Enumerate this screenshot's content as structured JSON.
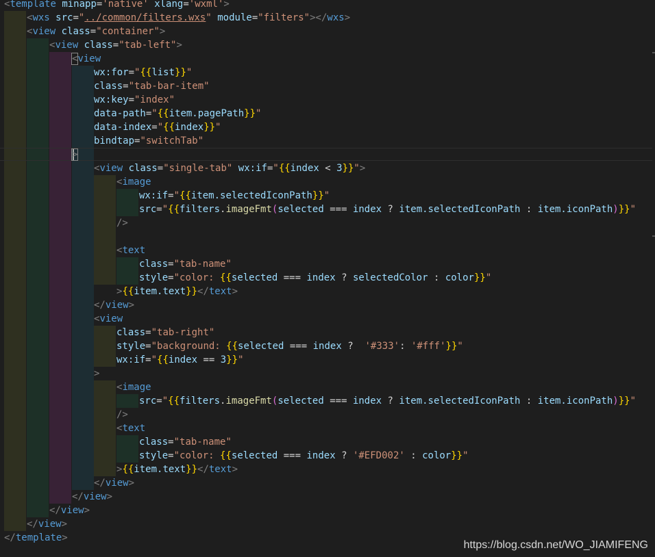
{
  "editor": {
    "lines": [
      [
        [
          "tagb",
          "<"
        ],
        [
          "tag",
          "template"
        ],
        [
          "op",
          " "
        ],
        [
          "attr",
          "minapp"
        ],
        [
          "op",
          "="
        ],
        [
          "str",
          "'native'"
        ],
        [
          "op",
          " "
        ],
        [
          "attr",
          "xlang"
        ],
        [
          "op",
          "="
        ],
        [
          "str",
          "'wxml'"
        ],
        [
          "tagb",
          ">"
        ]
      ],
      [
        [
          "tagb",
          "<"
        ],
        [
          "tag",
          "wxs"
        ],
        [
          "op",
          " "
        ],
        [
          "attr",
          "src"
        ],
        [
          "op",
          "="
        ],
        [
          "str",
          "\""
        ],
        [
          "stru",
          "../common/filters.wxs"
        ],
        [
          "str",
          "\""
        ],
        [
          "op",
          " "
        ],
        [
          "attr",
          "module"
        ],
        [
          "op",
          "="
        ],
        [
          "str",
          "\"filters\""
        ],
        [
          "tagb",
          "></"
        ],
        [
          "tag",
          "wxs"
        ],
        [
          "tagb",
          ">"
        ]
      ],
      [
        [
          "tagb",
          "<"
        ],
        [
          "tag",
          "view"
        ],
        [
          "op",
          " "
        ],
        [
          "attr",
          "class"
        ],
        [
          "op",
          "="
        ],
        [
          "str",
          "\"container\""
        ],
        [
          "tagb",
          ">"
        ]
      ],
      [
        [
          "tagb",
          "<"
        ],
        [
          "tag",
          "view"
        ],
        [
          "op",
          " "
        ],
        [
          "attr",
          "class"
        ],
        [
          "op",
          "="
        ],
        [
          "str",
          "\"tab-left\""
        ],
        [
          "tagb",
          ">"
        ]
      ],
      [
        [
          "tagb",
          "<"
        ],
        [
          "tag",
          "view"
        ]
      ],
      [
        [
          "attr",
          "wx:for"
        ],
        [
          "op",
          "="
        ],
        [
          "str",
          "\""
        ],
        [
          "b1",
          "{{"
        ],
        [
          "var",
          "list"
        ],
        [
          "b1",
          "}}"
        ],
        [
          "str",
          "\""
        ]
      ],
      [
        [
          "attr",
          "class"
        ],
        [
          "op",
          "="
        ],
        [
          "str",
          "\"tab-bar-item\""
        ]
      ],
      [
        [
          "attr",
          "wx:key"
        ],
        [
          "op",
          "="
        ],
        [
          "str",
          "\"index\""
        ]
      ],
      [
        [
          "attr",
          "data-path"
        ],
        [
          "op",
          "="
        ],
        [
          "str",
          "\""
        ],
        [
          "b1",
          "{{"
        ],
        [
          "var",
          "item.pagePath"
        ],
        [
          "b1",
          "}}"
        ],
        [
          "str",
          "\""
        ]
      ],
      [
        [
          "attr",
          "data-index"
        ],
        [
          "op",
          "="
        ],
        [
          "str",
          "\""
        ],
        [
          "b1",
          "{{"
        ],
        [
          "var",
          "index"
        ],
        [
          "b1",
          "}}"
        ],
        [
          "str",
          "\""
        ]
      ],
      [
        [
          "attr",
          "bindtap"
        ],
        [
          "op",
          "="
        ],
        [
          "str",
          "\"switchTab\""
        ]
      ],
      [
        [
          "tagb",
          ">"
        ]
      ],
      [
        [
          "tagb",
          "<"
        ],
        [
          "tag",
          "view"
        ],
        [
          "op",
          " "
        ],
        [
          "attr",
          "class"
        ],
        [
          "op",
          "="
        ],
        [
          "str",
          "\"single-tab\""
        ],
        [
          "op",
          " "
        ],
        [
          "attr",
          "wx:if"
        ],
        [
          "op",
          "="
        ],
        [
          "str",
          "\""
        ],
        [
          "b1",
          "{{"
        ],
        [
          "var",
          "index"
        ],
        [
          "op",
          " < "
        ],
        [
          "var",
          "3"
        ],
        [
          "b1",
          "}}"
        ],
        [
          "str",
          "\""
        ],
        [
          "tagb",
          ">"
        ]
      ],
      [
        [
          "tagb",
          "<"
        ],
        [
          "tag",
          "image"
        ]
      ],
      [
        [
          "attr",
          "wx:if"
        ],
        [
          "op",
          "="
        ],
        [
          "str",
          "\""
        ],
        [
          "b1",
          "{{"
        ],
        [
          "var",
          "item.selectedIconPath"
        ],
        [
          "b1",
          "}}"
        ],
        [
          "str",
          "\""
        ]
      ],
      [
        [
          "attr",
          "src"
        ],
        [
          "op",
          "="
        ],
        [
          "str",
          "\""
        ],
        [
          "b1",
          "{{"
        ],
        [
          "var",
          "filters"
        ],
        [
          "op",
          "."
        ],
        [
          "fn",
          "imageFmt"
        ],
        [
          "b2",
          "("
        ],
        [
          "var",
          "selected"
        ],
        [
          "op",
          " === "
        ],
        [
          "var",
          "index"
        ],
        [
          "op",
          " ? "
        ],
        [
          "var",
          "item.selectedIconPath"
        ],
        [
          "op",
          " : "
        ],
        [
          "var",
          "item.iconPath"
        ],
        [
          "b2",
          ")"
        ],
        [
          "b1",
          "}}"
        ],
        [
          "str",
          "\""
        ]
      ],
      [
        [
          "tagb",
          "/>"
        ]
      ],
      [],
      [
        [
          "tagb",
          "<"
        ],
        [
          "tag",
          "text"
        ]
      ],
      [
        [
          "attr",
          "class"
        ],
        [
          "op",
          "="
        ],
        [
          "str",
          "\"tab-name\""
        ]
      ],
      [
        [
          "attr",
          "style"
        ],
        [
          "op",
          "="
        ],
        [
          "str",
          "\"color: "
        ],
        [
          "b1",
          "{{"
        ],
        [
          "var",
          "selected"
        ],
        [
          "op",
          " === "
        ],
        [
          "var",
          "index"
        ],
        [
          "op",
          " ? "
        ],
        [
          "var",
          "selectedColor"
        ],
        [
          "op",
          " : "
        ],
        [
          "var",
          "color"
        ],
        [
          "b1",
          "}}"
        ],
        [
          "str",
          "\""
        ]
      ],
      [
        [
          "tagb",
          ">"
        ],
        [
          "b1",
          "{{"
        ],
        [
          "var",
          "item.text"
        ],
        [
          "b1",
          "}}"
        ],
        [
          "tagb",
          "</"
        ],
        [
          "tag",
          "text"
        ],
        [
          "tagb",
          ">"
        ]
      ],
      [
        [
          "tagb",
          "</"
        ],
        [
          "tag",
          "view"
        ],
        [
          "tagb",
          ">"
        ]
      ],
      [
        [
          "tagb",
          "<"
        ],
        [
          "tag",
          "view"
        ]
      ],
      [
        [
          "attr",
          "class"
        ],
        [
          "op",
          "="
        ],
        [
          "str",
          "\"tab-right\""
        ]
      ],
      [
        [
          "attr",
          "style"
        ],
        [
          "op",
          "="
        ],
        [
          "str",
          "\"background: "
        ],
        [
          "b1",
          "{{"
        ],
        [
          "var",
          "selected"
        ],
        [
          "op",
          " === "
        ],
        [
          "var",
          "index"
        ],
        [
          "op",
          " ?  "
        ],
        [
          "str",
          "'#333'"
        ],
        [
          "op",
          ": "
        ],
        [
          "str",
          "'#fff'"
        ],
        [
          "b1",
          "}}"
        ],
        [
          "str",
          "\""
        ]
      ],
      [
        [
          "attr",
          "wx:if"
        ],
        [
          "op",
          "="
        ],
        [
          "str",
          "\""
        ],
        [
          "b1",
          "{{"
        ],
        [
          "var",
          "index"
        ],
        [
          "op",
          " == "
        ],
        [
          "var",
          "3"
        ],
        [
          "b1",
          "}}"
        ],
        [
          "str",
          "\""
        ]
      ],
      [
        [
          "tagb",
          ">"
        ]
      ],
      [
        [
          "tagb",
          "<"
        ],
        [
          "tag",
          "image"
        ]
      ],
      [
        [
          "attr",
          "src"
        ],
        [
          "op",
          "="
        ],
        [
          "str",
          "\""
        ],
        [
          "b1",
          "{{"
        ],
        [
          "var",
          "filters"
        ],
        [
          "op",
          "."
        ],
        [
          "fn",
          "imageFmt"
        ],
        [
          "b2",
          "("
        ],
        [
          "var",
          "selected"
        ],
        [
          "op",
          " === "
        ],
        [
          "var",
          "index"
        ],
        [
          "op",
          " ? "
        ],
        [
          "var",
          "item.selectedIconPath"
        ],
        [
          "op",
          " : "
        ],
        [
          "var",
          "item.iconPath"
        ],
        [
          "b2",
          ")"
        ],
        [
          "b1",
          "}}"
        ],
        [
          "str",
          "\""
        ]
      ],
      [
        [
          "tagb",
          "/>"
        ]
      ],
      [
        [
          "tagb",
          "<"
        ],
        [
          "tag",
          "text"
        ]
      ],
      [
        [
          "attr",
          "class"
        ],
        [
          "op",
          "="
        ],
        [
          "str",
          "\"tab-name\""
        ]
      ],
      [
        [
          "attr",
          "style"
        ],
        [
          "op",
          "="
        ],
        [
          "str",
          "\"color: "
        ],
        [
          "b1",
          "{{"
        ],
        [
          "var",
          "selected"
        ],
        [
          "op",
          " === "
        ],
        [
          "var",
          "index"
        ],
        [
          "op",
          " ? "
        ],
        [
          "str",
          "'#EFD002'"
        ],
        [
          "op",
          " : "
        ],
        [
          "var",
          "color"
        ],
        [
          "b1",
          "}}"
        ],
        [
          "str",
          "\""
        ]
      ],
      [
        [
          "tagb",
          ">"
        ],
        [
          "b1",
          "{{"
        ],
        [
          "var",
          "item.text"
        ],
        [
          "b1",
          "}}"
        ],
        [
          "tagb",
          "</"
        ],
        [
          "tag",
          "text"
        ],
        [
          "tagb",
          ">"
        ]
      ],
      [
        [
          "tagb",
          "</"
        ],
        [
          "tag",
          "view"
        ],
        [
          "tagb",
          ">"
        ]
      ],
      [
        [
          "tagb",
          "</"
        ],
        [
          "tag",
          "view"
        ],
        [
          "tagb",
          ">"
        ]
      ],
      [
        [
          "tagb",
          "</"
        ],
        [
          "tag",
          "view"
        ],
        [
          "tagb",
          ">"
        ]
      ],
      [
        [
          "tagb",
          "</"
        ],
        [
          "tag",
          "view"
        ],
        [
          "tagb",
          ">"
        ]
      ],
      [
        [
          "tagb",
          "</"
        ],
        [
          "tag",
          "template"
        ],
        [
          "tagb",
          ">"
        ]
      ]
    ]
  },
  "watermark": "https://blog.csdn.net/WO_JIAMIFENG",
  "colors": {
    "background": "#1e1e1e",
    "tag": "#569cd6",
    "attribute": "#9cdcfe",
    "string": "#ce9178",
    "function": "#dcdcaa",
    "bracket_level1": "#ffd700",
    "bracket_level2": "#da70d6",
    "indent_guide_1": "#2f3020",
    "indent_guide_2": "#1d3027",
    "indent_guide_3": "#382236",
    "indent_guide_4": "#1d2d33"
  }
}
